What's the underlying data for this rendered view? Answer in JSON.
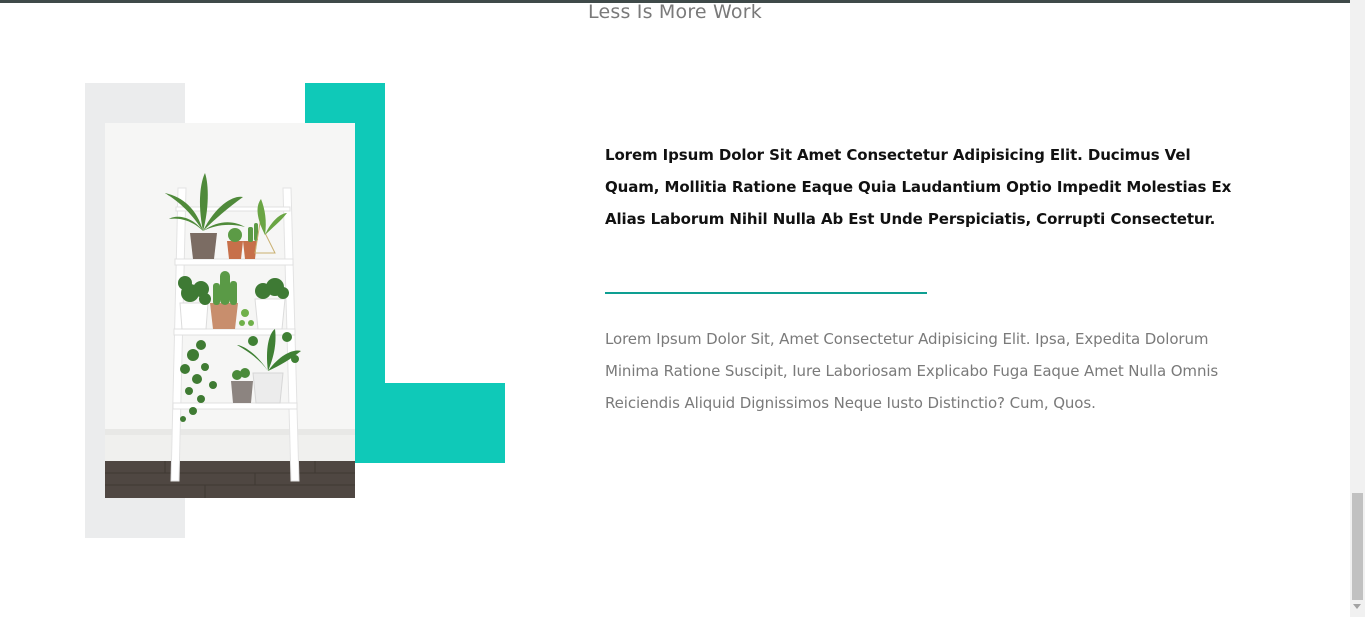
{
  "section": {
    "subtitle": "Less Is More Work"
  },
  "image": {
    "alt": "white ladder shelf with potted plants"
  },
  "content": {
    "lead": "Lorem Ipsum Dolor Sit Amet Consectetur Adipisicing Elit. Ducimus Vel Quam, Mollitia Ratione Eaque Quia Laudantium Optio Impedit Molestias Ex Alias Laborum Nihil Nulla Ab Est Unde Perspiciatis, Corrupti Consectetur.",
    "body": "Lorem Ipsum Dolor Sit, Amet Consectetur Adipisicing Elit. Ipsa, Expedita Dolorum Minima Ratione Suscipit, Iure Laboriosam Explicabo Fuga Eaque Amet Nulla Omnis Reiciendis Aliquid Dignissimos Neque Iusto Distinctio? Cum, Quos."
  },
  "colors": {
    "accent": "#0fc9b8",
    "divider": "#0e9f92",
    "muted_block": "#ebeced",
    "text_muted": "#7a7a7a",
    "text_strong": "#111111"
  },
  "scroll": {
    "position": 0.83
  }
}
